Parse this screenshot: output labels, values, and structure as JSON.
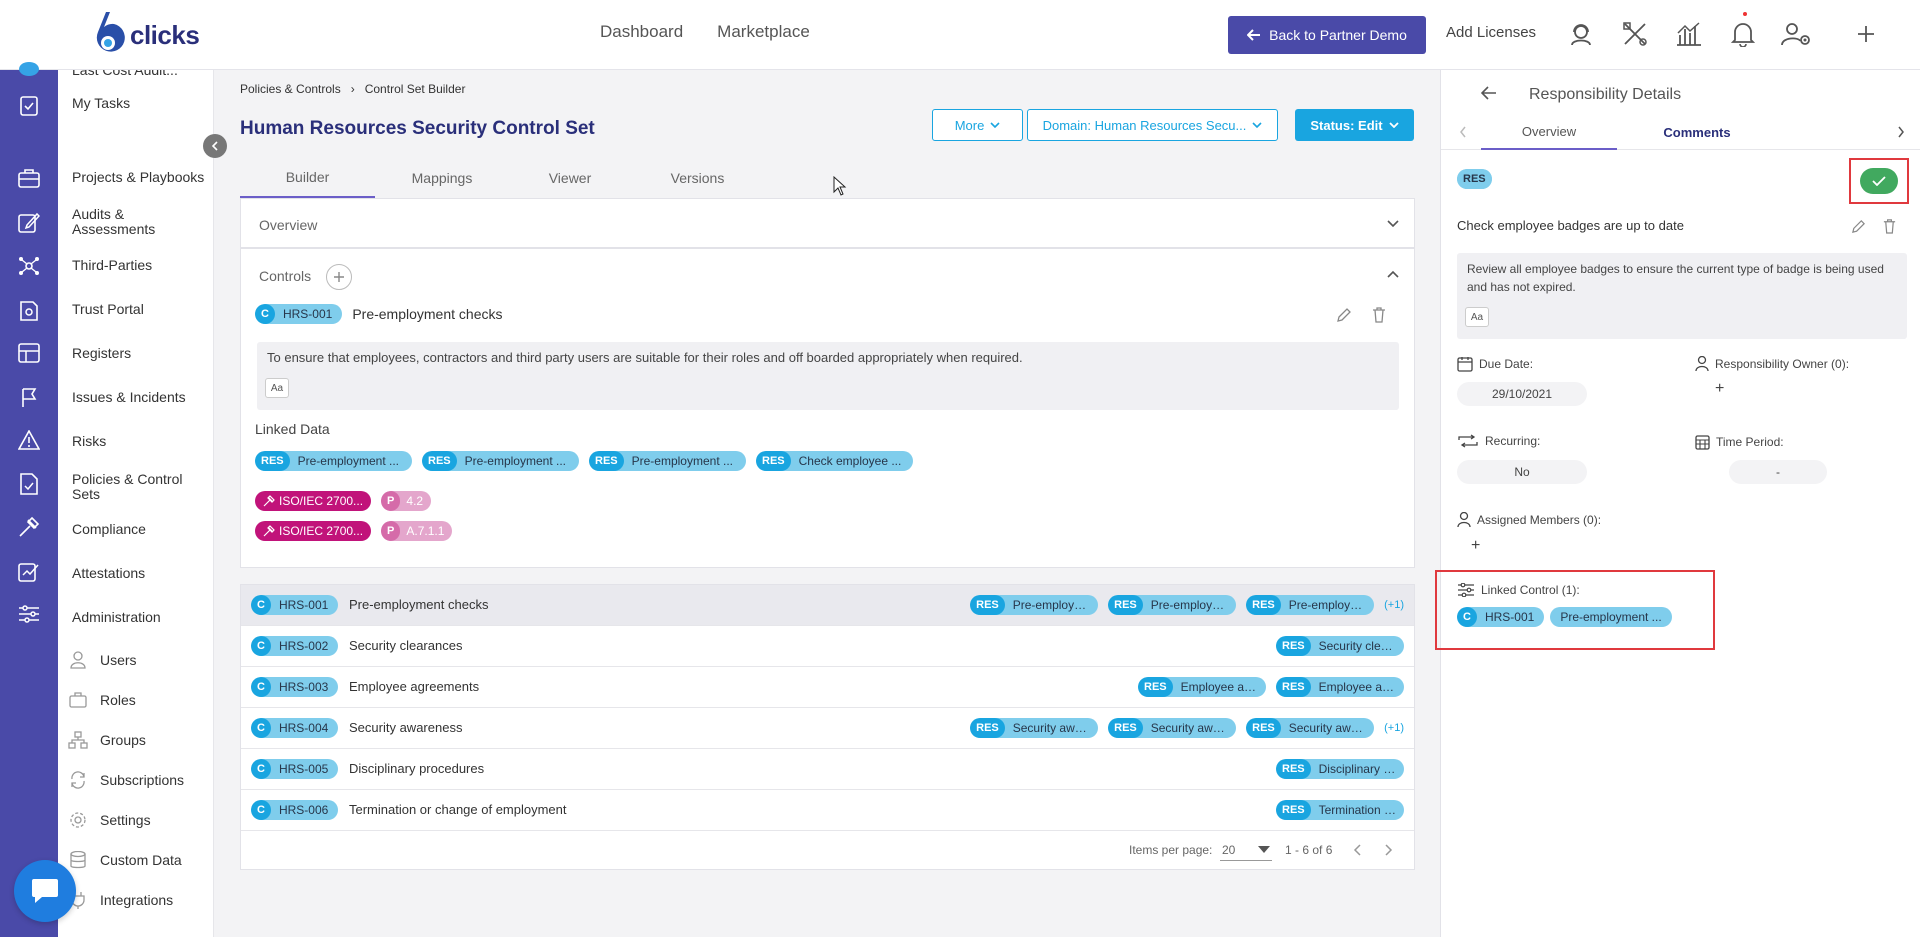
{
  "brand": {
    "name": "clicks",
    "accent": "#4a4aa8",
    "primary": "#19a5e0"
  },
  "topnav": {
    "dashboard": "Dashboard",
    "marketplace": "Marketplace",
    "back_button": "Back to Partner Demo",
    "add_licenses": "Add Licenses"
  },
  "sidebar": {
    "cut_item": "Last Cost Audit...",
    "items": [
      "My Tasks",
      "Projects & Playbooks",
      "Audits & Assessments",
      "Third-Parties",
      "Trust Portal",
      "Registers",
      "Issues & Incidents",
      "Risks",
      "Policies & Control Sets",
      "Compliance",
      "Attestations",
      "Administration"
    ],
    "admin_sub": [
      "Users",
      "Roles",
      "Groups",
      "Subscriptions",
      "Settings",
      "Custom Data",
      "Integrations"
    ]
  },
  "breadcrumb": {
    "root": "Policies & Controls",
    "current": "Control Set Builder"
  },
  "page": {
    "title": "Human Resources Security Control Set",
    "more_button": "More",
    "domain_button": "Domain: Human Resources Secu...",
    "status_button": "Status: Edit",
    "tabs": [
      "Builder",
      "Mappings",
      "Viewer",
      "Versions"
    ]
  },
  "overview": {
    "label": "Overview"
  },
  "controls": {
    "label": "Controls",
    "selected": {
      "tag": "C",
      "code": "HRS-001",
      "name": "Pre-employment checks",
      "description": "To ensure that employees, contractors and third party users are suitable for their roles and off boarded appropriately when required.",
      "aa": "Aa",
      "linked_data_label": "Linked Data",
      "linked_res": [
        "Pre-employment ...",
        "Pre-employment ...",
        "Pre-employment ...",
        "Check employee ..."
      ],
      "res_tag": "RES",
      "frameworks": [
        {
          "name": "ISO/IEC 2700...",
          "tag": "P",
          "clause": "4.2"
        },
        {
          "name": "ISO/IEC 2700...",
          "tag": "P",
          "clause": "A.7.1.1"
        }
      ]
    }
  },
  "list": {
    "rows": [
      {
        "code": "HRS-001",
        "name": "Pre-employment checks",
        "links": [
          "Pre-employment ...",
          "Pre-employment ...",
          "Pre-employment ..."
        ],
        "more": "(+1)"
      },
      {
        "code": "HRS-002",
        "name": "Security clearances",
        "links": [
          "Security clearanc..."
        ],
        "more": ""
      },
      {
        "code": "HRS-003",
        "name": "Employee agreements",
        "links": [
          "Employee agreem...",
          "Employee agreem..."
        ],
        "more": ""
      },
      {
        "code": "HRS-004",
        "name": "Security awareness",
        "links": [
          "Security awarene...",
          "Security awarene...",
          "Security awarene..."
        ],
        "more": "(+1)"
      },
      {
        "code": "HRS-005",
        "name": "Disciplinary procedures",
        "links": [
          "Disciplinary proce..."
        ],
        "more": ""
      },
      {
        "code": "HRS-006",
        "name": "Termination or change of employment",
        "links": [
          "Termination or ch..."
        ],
        "more": ""
      }
    ],
    "pager": {
      "items_label": "Items per page:",
      "per_page": "20",
      "range": "1 - 6 of 6"
    }
  },
  "panel": {
    "title": "Responsibility Details",
    "tabs": [
      "Overview",
      "Comments"
    ],
    "res_tag": "RES",
    "resp_title": "Check employee badges are up to date",
    "resp_desc": "Review all employee badges to ensure the current type of badge is being used and has not expired.",
    "aa": "Aa",
    "due_date_label": "Due Date:",
    "due_date": "29/10/2021",
    "owner_label": "Responsibility Owner (0):",
    "recurring_label": "Recurring:",
    "recurring": "No",
    "time_period_label": "Time Period:",
    "time_period": "-",
    "members_label": "Assigned Members (0):",
    "linked_control_label": "Linked Control (1):",
    "linked_control_code": "HRS-001",
    "linked_control_name": "Pre-employment ...",
    "plus": "+"
  }
}
